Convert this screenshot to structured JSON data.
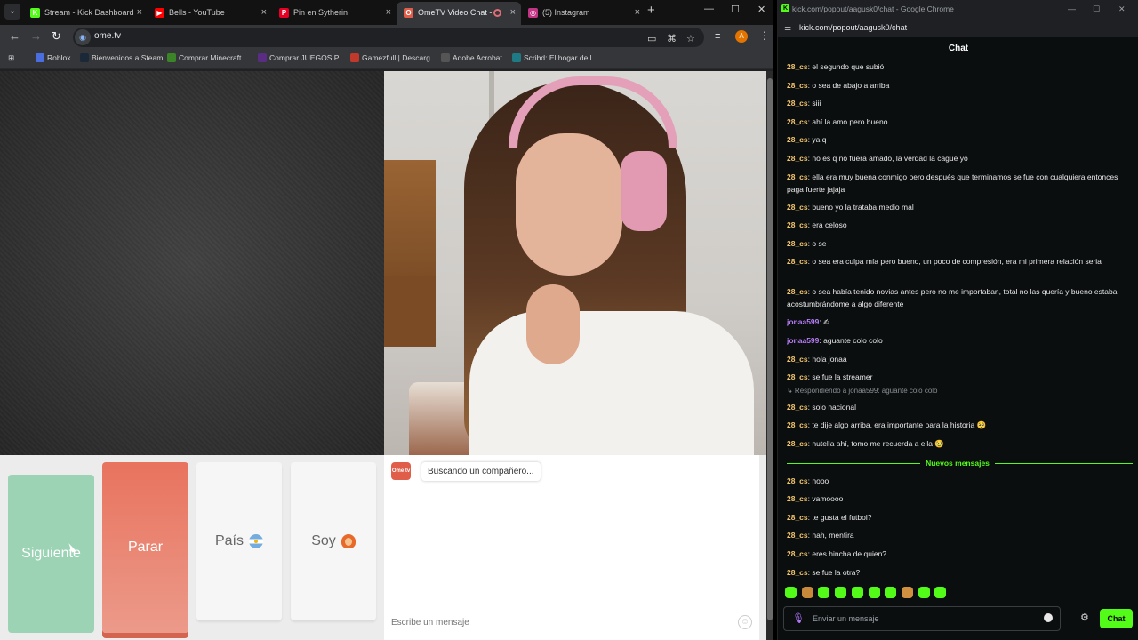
{
  "browser": {
    "tabs": [
      {
        "title": "Stream - Kick Dashboard",
        "favicon": "K",
        "color": "#53fc18"
      },
      {
        "title": "Bells - YouTube",
        "favicon": "▶",
        "color": "#ff0000"
      },
      {
        "title": "Pin en Sytherin",
        "favicon": "P",
        "color": "#e60023"
      },
      {
        "title": "OmeTV Video Chat -",
        "favicon": "O",
        "color": "#e05d4a"
      },
      {
        "title": "(5) Instagram",
        "favicon": "◎",
        "color": "#c13584"
      }
    ],
    "url": "ome.tv",
    "avatar_letter": "A",
    "bookmarks": [
      {
        "label": "Roblox",
        "color": "#4a6ee0"
      },
      {
        "label": "Bienvenidos a Steam",
        "color": "#1b2838"
      },
      {
        "label": "Comprar Minecraft...",
        "color": "#3c8527"
      },
      {
        "label": "Comprar JUEGOS P...",
        "color": "#5b2c83"
      },
      {
        "label": "Gamezfull | Descarg...",
        "color": "#c0392b"
      },
      {
        "label": "Adobe Acrobat",
        "color": "#555"
      },
      {
        "label": "Scribd: El hogar de l...",
        "color": "#1e7b85"
      }
    ]
  },
  "ometv": {
    "buttons": {
      "next": "Siguiente",
      "stop": "Parar",
      "country": "País",
      "me": "Soy"
    },
    "logo_text": "Ome tv",
    "status_bubble": "Buscando un compañero...",
    "message_placeholder": "Escribe un mensaje"
  },
  "kick_popout": {
    "window_title": "kick.com/popout/aagusk0/chat - Google Chrome",
    "url": "kick.com/popout/aagusk0/chat",
    "chat_title": "Chat",
    "new_messages_label": "Nuevos mensajes",
    "reply_note": "↳ Respondiendo a jonaa599: aguante colo colo",
    "messages_before": [
      {
        "user": "28_cs",
        "color": "#f5c76b",
        "text": "el segundo que subió"
      },
      {
        "user": "28_cs",
        "color": "#f5c76b",
        "text": "o sea de abajo a arriba"
      },
      {
        "user": "28_cs",
        "color": "#f5c76b",
        "text": "siii"
      },
      {
        "user": "28_cs",
        "color": "#f5c76b",
        "text": "ahí la amo pero bueno"
      },
      {
        "user": "28_cs",
        "color": "#f5c76b",
        "text": "ya q"
      },
      {
        "user": "28_cs",
        "color": "#f5c76b",
        "text": "no es q no fuera amado, la verdad la cague yo"
      },
      {
        "user": "28_cs",
        "color": "#f5c76b",
        "text": "ella era muy buena conmigo pero después que terminamos se fue con cualquiera entonces paga fuerte jajaja"
      },
      {
        "user": "28_cs",
        "color": "#f5c76b",
        "text": "bueno yo la trataba medio mal"
      },
      {
        "user": "28_cs",
        "color": "#f5c76b",
        "text": "era celoso"
      },
      {
        "user": "28_cs",
        "color": "#f5c76b",
        "text": "o se"
      },
      {
        "user": "28_cs",
        "color": "#f5c76b",
        "text": "o sea era culpa mía pero bueno, un poco de compresión, era mi primera relación seria"
      },
      {
        "user": "28_cs",
        "color": "#f5c76b",
        "text": "o sea había tenido novias antes pero no me importaban, total no las quería y bueno estaba acostumbrándome a algo diferente"
      },
      {
        "user": "jonaa599",
        "color": "#b57cf8",
        "text": "✍"
      },
      {
        "user": "jonaa599",
        "color": "#b57cf8",
        "text": "aguante colo colo"
      },
      {
        "user": "28_cs",
        "color": "#f5c76b",
        "text": "hola jonaa"
      },
      {
        "user": "28_cs",
        "color": "#f5c76b",
        "text": "se fue la streamer"
      },
      {
        "user": "28_cs",
        "color": "#f5c76b",
        "text": "solo nacional"
      },
      {
        "user": "28_cs",
        "color": "#f5c76b",
        "text": "te dije algo arriba, era importante para la historia 🥺"
      },
      {
        "user": "28_cs",
        "color": "#f5c76b",
        "text": "nutella ahí, tomo me recuerda a ella 🥹"
      }
    ],
    "messages_after": [
      {
        "user": "28_cs",
        "color": "#f5c76b",
        "text": "nooo"
      },
      {
        "user": "28_cs",
        "color": "#f5c76b",
        "text": "vamoooo"
      },
      {
        "user": "28_cs",
        "color": "#f5c76b",
        "text": "te gusta el futbol?"
      },
      {
        "user": "28_cs",
        "color": "#f5c76b",
        "text": "nah, mentira"
      },
      {
        "user": "28_cs",
        "color": "#f5c76b",
        "text": "eres hincha de quien?"
      },
      {
        "user": "28_cs",
        "color": "#f5c76b",
        "text": "se fue la otra?"
      }
    ],
    "emotes": [
      "#53fc18",
      "#c88a3a",
      "#53fc18",
      "#53fc18",
      "#53fc18",
      "#53fc18",
      "#53fc18",
      "#d09040",
      "#53fc18",
      "#53fc18"
    ],
    "input_placeholder": "Enviar un mensaje",
    "send_label": "Chat",
    "accent": "#53fc18"
  }
}
